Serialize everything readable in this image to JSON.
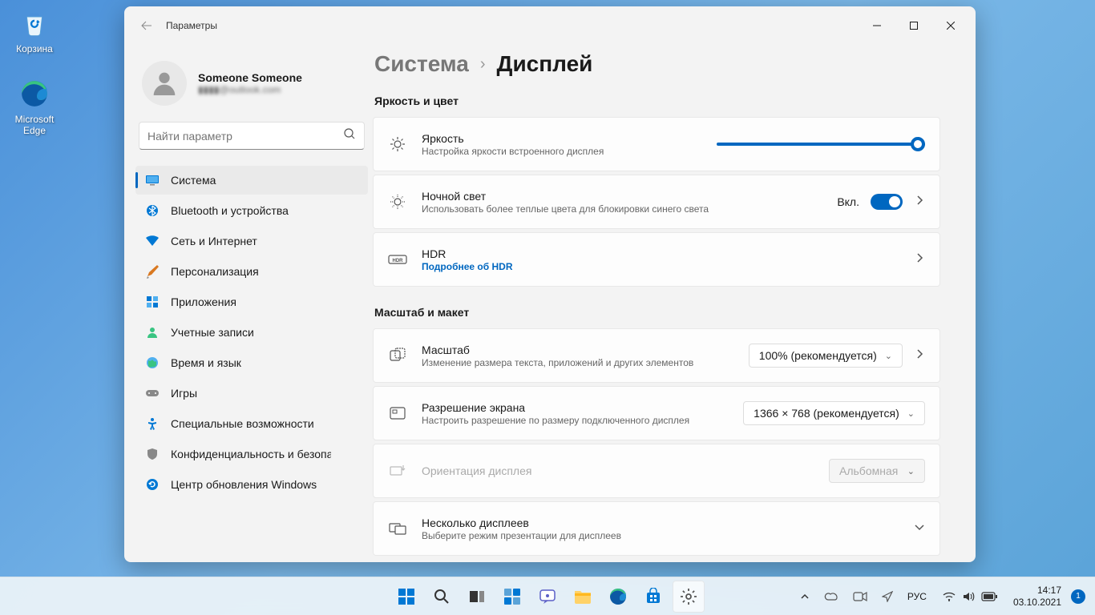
{
  "desktop": {
    "recycle_bin": "Корзина",
    "edge": "Microsoft\nEdge"
  },
  "window": {
    "title": "Параметры"
  },
  "user": {
    "name": "Someone Someone",
    "email": "▮▮▮▮@outlook.com"
  },
  "search": {
    "placeholder": "Найти параметр"
  },
  "nav": {
    "items": [
      "Система",
      "Bluetooth и устройства",
      "Сеть и Интернет",
      "Персонализация",
      "Приложения",
      "Учетные записи",
      "Время и язык",
      "Игры",
      "Специальные возможности",
      "Конфиденциальность и безопасность",
      "Центр обновления Windows"
    ]
  },
  "breadcrumb": {
    "parent": "Система",
    "current": "Дисплей"
  },
  "sections": {
    "brightness_color": "Яркость и цвет",
    "scale_layout": "Масштаб и макет"
  },
  "rows": {
    "brightness": {
      "title": "Яркость",
      "desc": "Настройка яркости встроенного дисплея"
    },
    "night_light": {
      "title": "Ночной свет",
      "desc": "Использовать более теплые цвета для блокировки синего света",
      "toggle_label": "Вкл."
    },
    "hdr": {
      "title": "HDR",
      "link": "Подробнее об HDR"
    },
    "scale": {
      "title": "Масштаб",
      "desc": "Изменение размера текста, приложений и других элементов",
      "value": "100% (рекомендуется)"
    },
    "resolution": {
      "title": "Разрешение экрана",
      "desc": "Настроить разрешение по размеру подключенного дисплея",
      "value": "1366 × 768 (рекомендуется)"
    },
    "orientation": {
      "title": "Ориентация дисплея",
      "value": "Альбомная"
    },
    "multiple": {
      "title": "Несколько дисплеев",
      "desc": "Выберите режим презентации для дисплеев"
    }
  },
  "taskbar": {
    "lang": "РУС",
    "time": "14:17",
    "date": "03.10.2021",
    "notif_count": "1"
  }
}
